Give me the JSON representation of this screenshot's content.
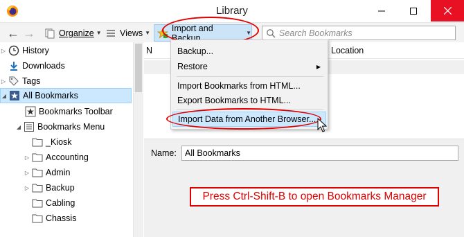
{
  "window": {
    "title": "Library"
  },
  "toolbar": {
    "organize_label": "Organize",
    "views_label": "Views",
    "import_backup_label": "Import and Backup",
    "search_placeholder": "Search Bookmarks"
  },
  "tree": {
    "items": [
      {
        "label": "History",
        "icon": "clock-icon"
      },
      {
        "label": "Downloads",
        "icon": "download-icon"
      },
      {
        "label": "Tags",
        "icon": "tag-icon"
      },
      {
        "label": "All Bookmarks",
        "icon": "star-icon",
        "selected": true
      },
      {
        "label": "Bookmarks Toolbar",
        "icon": "star-icon"
      },
      {
        "label": "Bookmarks Menu",
        "icon": "menu-icon"
      },
      {
        "label": "_Kiosk",
        "icon": "folder-icon"
      },
      {
        "label": "Accounting",
        "icon": "folder-icon"
      },
      {
        "label": "Admin",
        "icon": "folder-icon"
      },
      {
        "label": "Backup",
        "icon": "folder-icon"
      },
      {
        "label": "Cabling",
        "icon": "folder-icon"
      },
      {
        "label": "Chassis",
        "icon": "folder-icon"
      }
    ]
  },
  "list": {
    "columns": [
      "N",
      "Location"
    ]
  },
  "details": {
    "name_label": "Name:",
    "name_value": "All Bookmarks"
  },
  "menu": {
    "items": [
      {
        "label": "Backup..."
      },
      {
        "label": "Restore",
        "submenu": true
      },
      {
        "label": "Import Bookmarks from HTML..."
      },
      {
        "label": "Export Bookmarks to HTML..."
      },
      {
        "label": "Import Data from Another Browser...",
        "highlighted": true
      }
    ]
  },
  "annotation": {
    "note_text": "Press Ctrl-Shift-B to open Bookmarks Manager",
    "color": "#e00000"
  },
  "colors": {
    "selection": "#cce8ff",
    "close_button": "#e81123"
  }
}
